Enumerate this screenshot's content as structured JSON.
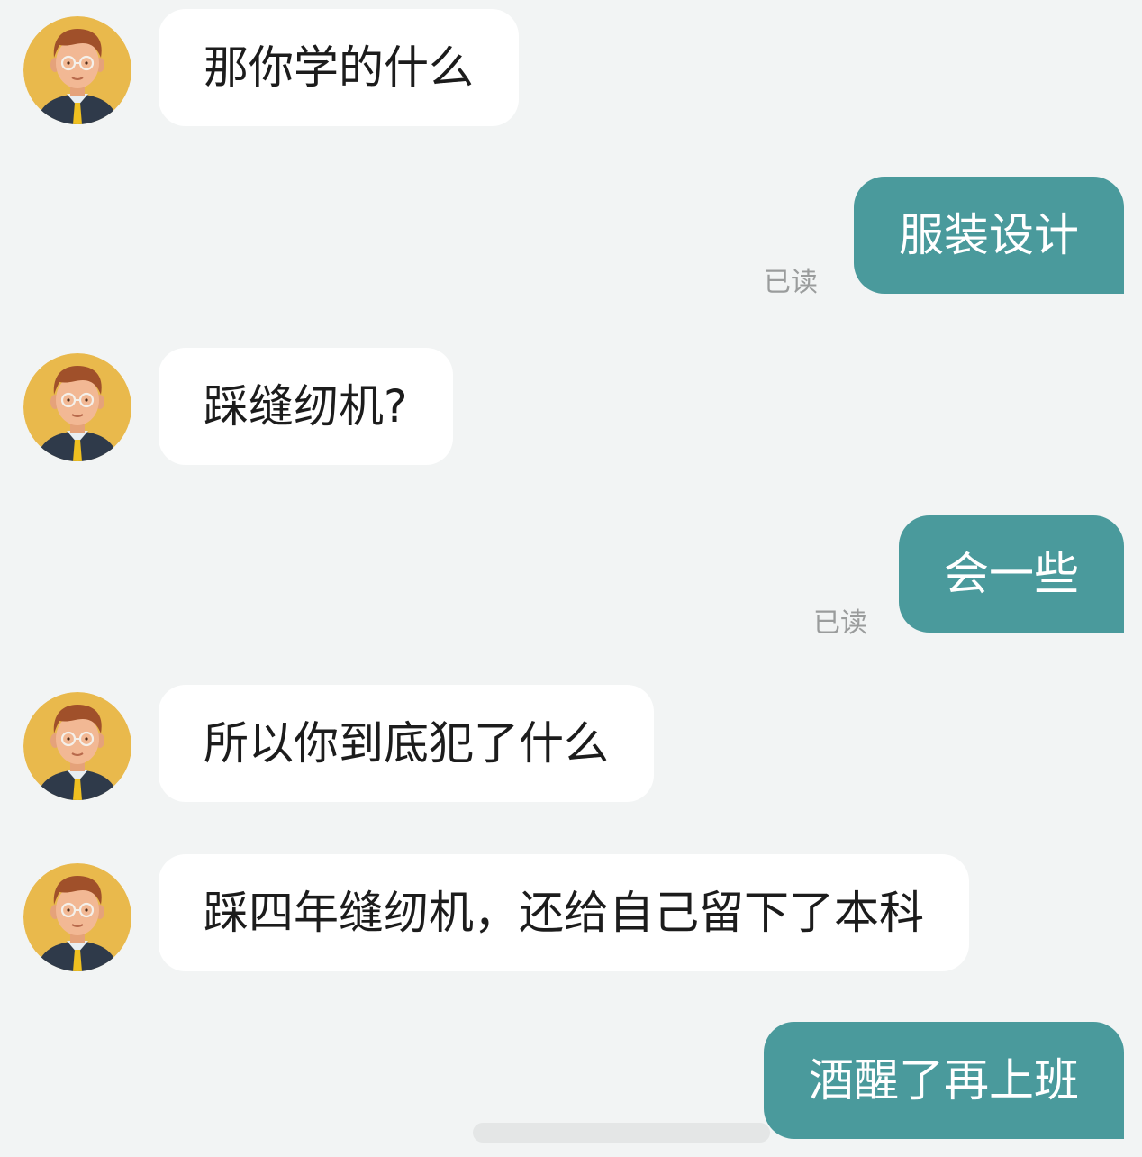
{
  "conversation": {
    "messages": [
      {
        "side": "incoming",
        "text": "那你学的什么",
        "avatar": "man-with-glasses-avatar"
      },
      {
        "side": "outgoing",
        "text": "服装设计",
        "status": "已读"
      },
      {
        "side": "incoming",
        "text": "踩缝纫机?",
        "avatar": "man-with-glasses-avatar"
      },
      {
        "side": "outgoing",
        "text": "会一些",
        "status": "已读"
      },
      {
        "side": "incoming",
        "text": "所以你到底犯了什么",
        "avatar": "man-with-glasses-avatar"
      },
      {
        "side": "incoming",
        "text": "踩四年缝纫机，还给自己留下了本科",
        "avatar": "man-with-glasses-avatar"
      },
      {
        "side": "outgoing",
        "text": "酒醒了再上班"
      }
    ]
  },
  "colors": {
    "background": "#f2f4f4",
    "incoming_bubble": "#ffffff",
    "outgoing_bubble": "#4a9a9c",
    "read_status": "#9a9c9c",
    "avatar_bg": "#e9b94c"
  }
}
